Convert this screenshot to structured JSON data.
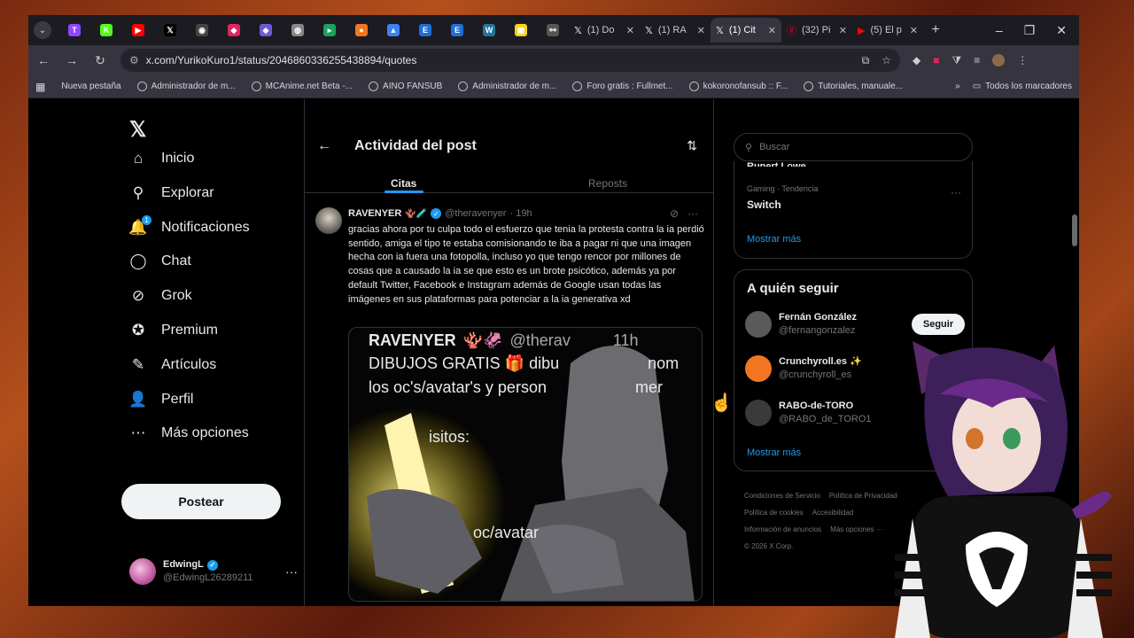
{
  "browser": {
    "tabs_favicons": [
      {
        "icon": "twitch-icon",
        "color": "#9146ff",
        "glyph": "T"
      },
      {
        "icon": "kick-icon",
        "color": "#53fc18",
        "glyph": "K"
      },
      {
        "icon": "youtube-icon",
        "color": "#ff0000",
        "glyph": "▶"
      },
      {
        "icon": "x-icon",
        "color": "#000000",
        "glyph": "𝕏"
      },
      {
        "icon": "site-icon",
        "color": "#444444",
        "glyph": "◉"
      },
      {
        "icon": "app-icon",
        "color": "#e0245e",
        "glyph": "◆"
      },
      {
        "icon": "shield-icon",
        "color": "#6b5bd6",
        "glyph": "◈"
      },
      {
        "icon": "globe-icon",
        "color": "#888888",
        "glyph": "◍"
      },
      {
        "icon": "play-icon",
        "color": "#1aa260",
        "glyph": "▸"
      },
      {
        "icon": "crunchyroll-icon",
        "color": "#f47521",
        "glyph": "●"
      },
      {
        "icon": "drop-icon",
        "color": "#3b82f6",
        "glyph": "▲"
      },
      {
        "icon": "e-icon",
        "color": "#1e6fd9",
        "glyph": "E"
      },
      {
        "icon": "e-icon",
        "color": "#1e6fd9",
        "glyph": "E"
      },
      {
        "icon": "wordpress-icon",
        "color": "#21759b",
        "glyph": "W"
      },
      {
        "icon": "yellow-icon",
        "color": "#f7d21b",
        "glyph": "▣"
      },
      {
        "icon": "link-icon",
        "color": "#555555",
        "glyph": "⚯"
      }
    ],
    "tabs": [
      {
        "icon": "x-icon",
        "label": "(1) Do"
      },
      {
        "icon": "x-icon",
        "label": "(1) RA"
      },
      {
        "icon": "x-icon",
        "label": "(1) Cit",
        "active": true
      },
      {
        "icon": "pinterest-icon",
        "label": "(32) Pi"
      },
      {
        "icon": "youtube-icon",
        "label": "(5) El p"
      }
    ],
    "url": "x.com/YurikoKuro1/status/2046860336255438894/quotes",
    "bookmarks": [
      "Nueva pestaña",
      "Administrador de m...",
      "MCAnime.net Beta -...",
      "AINO FANSUB",
      "Administrador de m...",
      "Foro gratis : Fullmet...",
      "kokoronofansub :: F...",
      "Tutoriales, manuale..."
    ],
    "bookmarks_more": "»",
    "all_bookmarks": "Todos los marcadores"
  },
  "nav": {
    "items": [
      {
        "label": "Inicio",
        "icon": "home-icon",
        "glyph": "⌂"
      },
      {
        "label": "Explorar",
        "icon": "search-icon",
        "glyph": "⚲"
      },
      {
        "label": "Notificaciones",
        "icon": "bell-icon",
        "glyph": "🔔",
        "badge": "1"
      },
      {
        "label": "Chat",
        "icon": "chat-icon",
        "glyph": "◯"
      },
      {
        "label": "Grok",
        "icon": "grok-icon",
        "glyph": "⊘"
      },
      {
        "label": "Premium",
        "icon": "premium-icon",
        "glyph": "✪"
      },
      {
        "label": "Artículos",
        "icon": "articles-icon",
        "glyph": "✎"
      },
      {
        "label": "Perfil",
        "icon": "profile-icon",
        "glyph": "👤"
      },
      {
        "label": "Más opciones",
        "icon": "more-icon",
        "glyph": "⋯"
      }
    ],
    "post_button": "Postear",
    "account": {
      "name": "EdwingL",
      "handle": "@EdwingL26289211"
    }
  },
  "main": {
    "title": "Actividad del post",
    "tabs": [
      "Citas",
      "Reposts"
    ],
    "tweet": {
      "name": "RAVENYER",
      "handle": "@theravenyer",
      "time": "· 19h",
      "text": "gracias ahora por tu culpa todo el esfuerzo que tenia la protesta contra la ia perdió sentido, amiga el tipo te estaba comisionando te iba a pagar ni que una imagen hecha con ia fuera una fotopolla, incluso yo que tengo rencor por millones de cosas que a causado la ia se que esto es un brote psicótico, además ya por default Twitter, Facebook e Instagram además de Google usan todas las imágenes en sus plataformas para potenciar a la ia generativa xd",
      "media": {
        "line1_name": "RAVENYER",
        "line1_handle": "@therav",
        "line1_time": "11h",
        "line2": "DIBUJOS GRATIS 🎁 dibu",
        "line2_tail": "nom",
        "line3": "los oc's/avatar's y person",
        "line3_tail": "mer",
        "line4": "isitos:",
        "line5": "oc/avatar"
      }
    }
  },
  "right": {
    "search_placeholder": "Buscar",
    "trend_cut": "Rupert Lowe",
    "trend_meta": "Gaming · Tendencia",
    "trend_name": "Switch",
    "show_more": "Mostrar más",
    "follow_title": "A quién seguir",
    "follow": [
      {
        "name": "Fernán González",
        "handle": "@fernangonzalez",
        "button": "Seguir",
        "color": "#5a5a5a"
      },
      {
        "name": "Crunchyroll.es ✨",
        "handle": "@crunchyroll_es",
        "button": "",
        "color": "#f47521"
      },
      {
        "name": "RABO-de-TORO",
        "handle": "@RABO_de_TORO1",
        "button": "",
        "color": "#3a3a3a"
      }
    ],
    "footer": [
      "Condiciones de Servicio",
      "Política de Privacidad",
      "Política de cookies",
      "Accesibilidad",
      "Información de anuncios",
      "Más opciones ···",
      "© 2026 X Corp."
    ]
  }
}
